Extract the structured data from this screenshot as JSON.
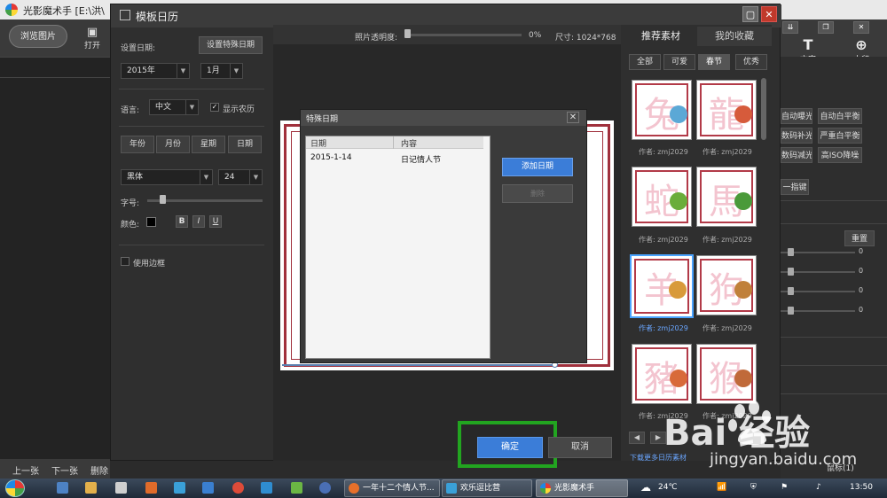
{
  "app": {
    "title": "光影魔术手 [E:\\洪\\",
    "browse_label": "浏览图片",
    "open_label": "打开",
    "bottom_nav": [
      "上一张",
      "下一张",
      "删除"
    ],
    "right_tools": [
      {
        "label": "文字",
        "icon": "text-icon"
      },
      {
        "label": "水印",
        "icon": "watermark-icon"
      }
    ],
    "right_buttons": [
      "自动曝光",
      "自动白平衡",
      "数码补光",
      "严重白平衡",
      "数码减光",
      "高ISO降噪",
      "一指键"
    ],
    "reset_label": "重置",
    "slider_values": [
      "0",
      "0",
      "0",
      "0"
    ],
    "bottom_right_text": "鼠标(1)"
  },
  "dialog": {
    "title": "模板日历",
    "start_date_label": "设置日期:",
    "special_date_button": "设置特殊日期",
    "year_value": "2015年",
    "month_value": "1月",
    "language_label": "语言:",
    "language_value": "中文",
    "show_lunar_label": "显示农历",
    "show_lunar_checked": true,
    "segments": [
      "年份",
      "月份",
      "星期",
      "日期"
    ],
    "font_value": "黑体",
    "size_value": "24",
    "font_size_label": "字号:",
    "color_label": "颜色:",
    "color_value": "#000000",
    "style_buttons": [
      "B",
      "I",
      "U"
    ],
    "use_border_label": "使用边框",
    "opacity_label": "照片透明度:",
    "opacity_value": "0%",
    "size_label": "尺寸: 1024*768",
    "ok_label": "确定",
    "cancel_label": "取消"
  },
  "materials": {
    "tabs": [
      "推荐素材",
      "我的收藏"
    ],
    "categories": [
      "全部",
      "可爱",
      "春节",
      "优秀"
    ],
    "active_category": "春节",
    "thumbs": [
      {
        "glyph": "兔",
        "author": "作者: zmj2029"
      },
      {
        "glyph": "龍",
        "author": "作者: zmj2029"
      },
      {
        "glyph": "蛇",
        "author": "作者: zmj2029"
      },
      {
        "glyph": "馬",
        "author": "作者: zmj2029"
      },
      {
        "glyph": "羊",
        "author": "作者: zmj2029"
      },
      {
        "glyph": "狗",
        "author": "作者: zmj2029"
      },
      {
        "glyph": "豬",
        "author": "作者: zmj2029"
      },
      {
        "glyph": "猴",
        "author": "作者: zmj2029"
      }
    ],
    "download_link": "下载更多日历素材"
  },
  "special_dates": {
    "title": "特殊日期",
    "col_date": "日期",
    "col_content": "内容",
    "rows": [
      {
        "date": "2015-1-14",
        "content": "日记情人节"
      }
    ],
    "add_label": "添加日期",
    "delete_label": "删除"
  },
  "taskbar": {
    "tasks": [
      "一年十二个情人节...",
      "欢乐逗比营",
      "光影魔术手"
    ],
    "weather": "24℃",
    "time": "13:50"
  },
  "watermark": {
    "logo_text": "Bai  经验",
    "url": "jingyan.baidu.com"
  }
}
